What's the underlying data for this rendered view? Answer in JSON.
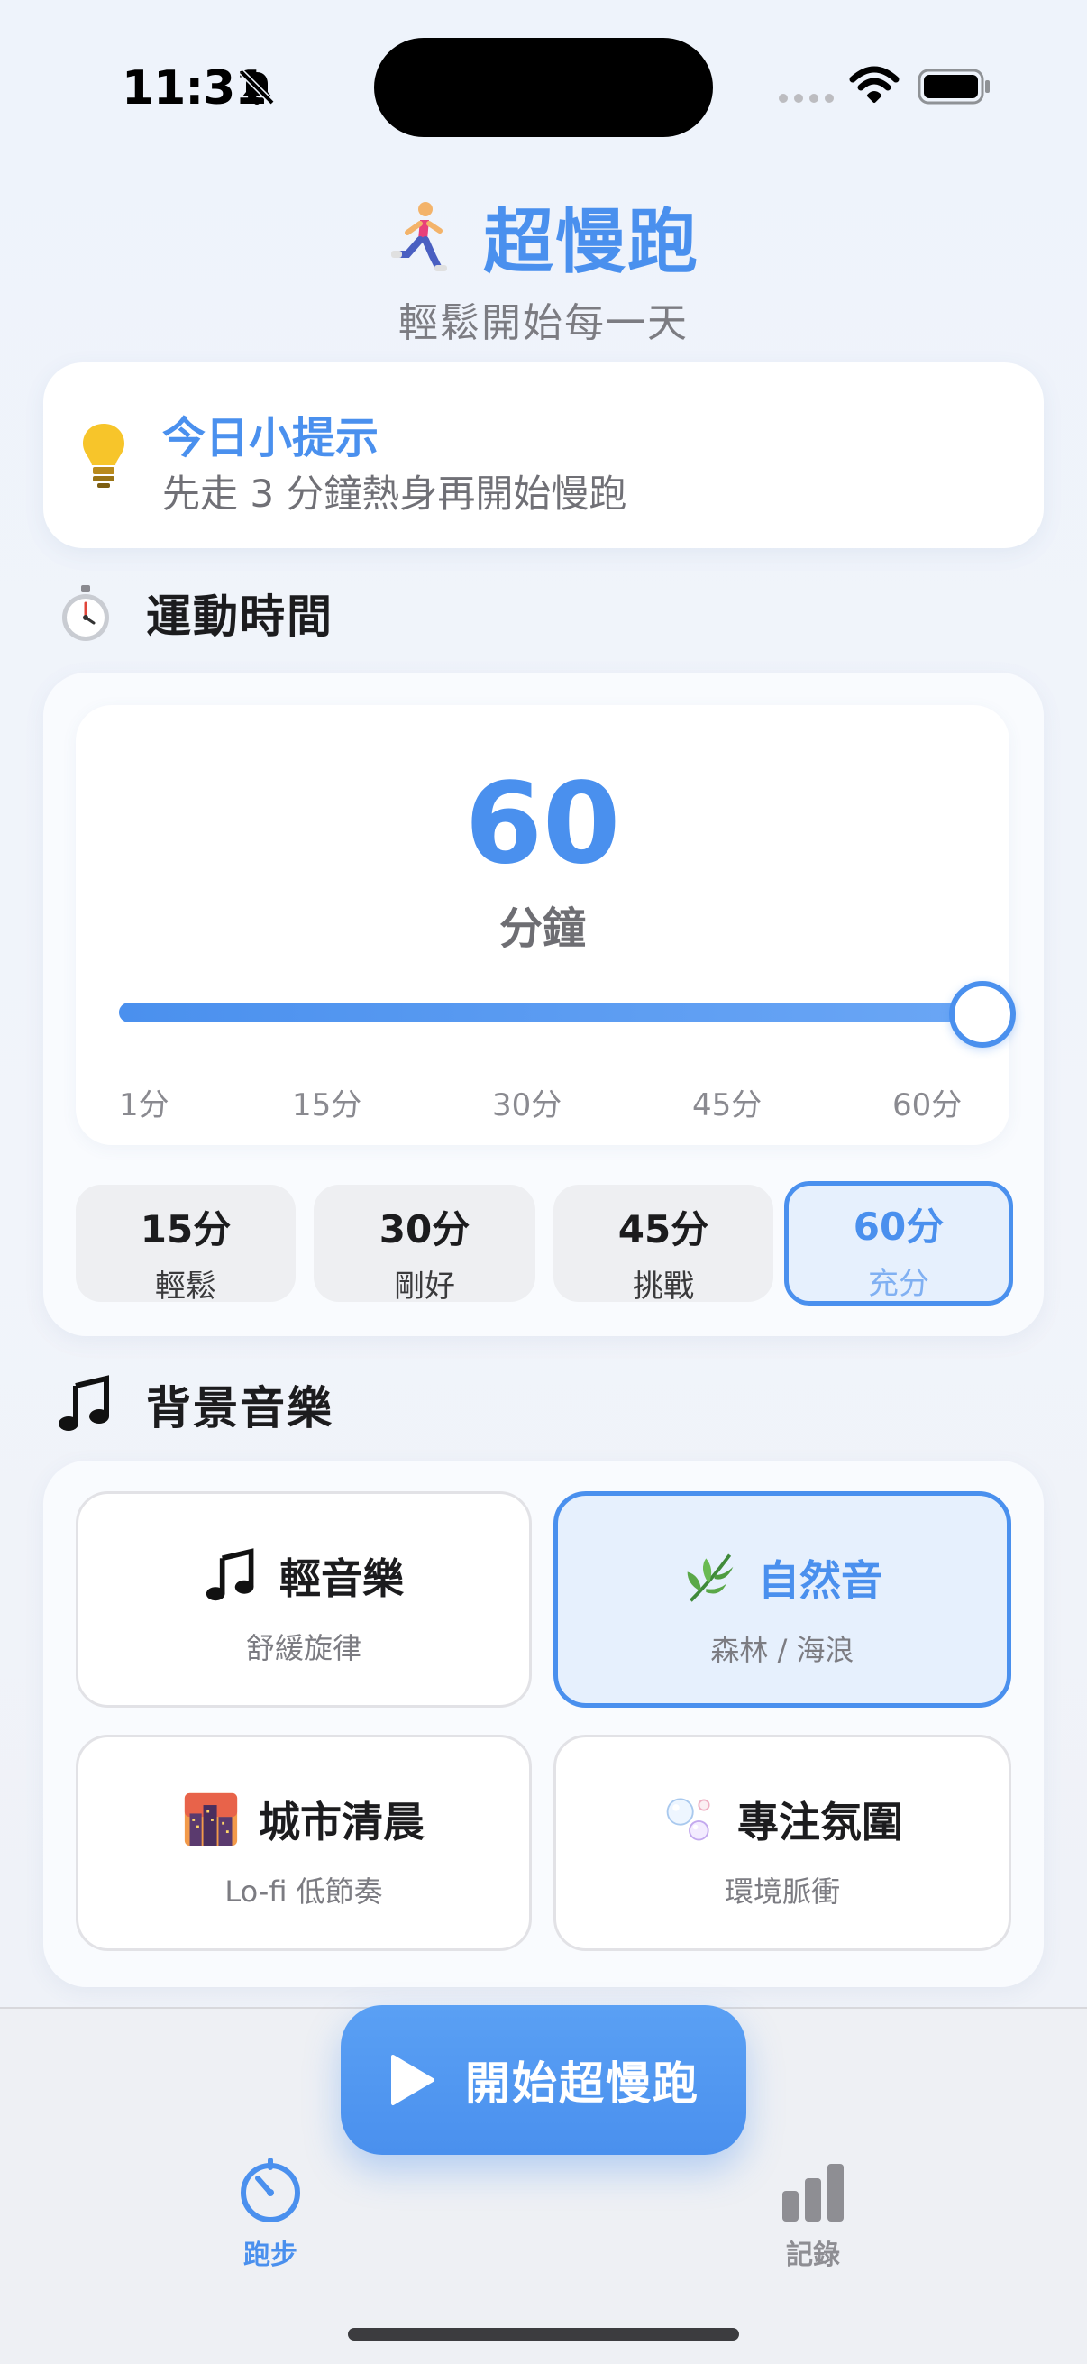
{
  "status_bar": {
    "time": "11:31"
  },
  "header": {
    "title": "超慢跑",
    "subtitle": "輕鬆開始每一天"
  },
  "tip": {
    "title": "今日小提示",
    "body": "先走 3 分鐘熱身再開始慢跑"
  },
  "duration_section": {
    "title": "運動時間",
    "value": "60",
    "unit": "分鐘",
    "slider": {
      "min": 1,
      "max": 60,
      "current": 60
    },
    "ticks": [
      "1分",
      "15分",
      "30分",
      "45分",
      "60分"
    ],
    "presets": [
      {
        "value": "15分",
        "label": "輕鬆",
        "selected": false
      },
      {
        "value": "30分",
        "label": "剛好",
        "selected": false
      },
      {
        "value": "45分",
        "label": "挑戰",
        "selected": false
      },
      {
        "value": "60分",
        "label": "充分",
        "selected": true
      }
    ]
  },
  "music_section": {
    "title": "背景音樂",
    "options": [
      {
        "name": "輕音樂",
        "desc": "舒緩旋律",
        "icon": "music-note-icon",
        "selected": false
      },
      {
        "name": "自然音",
        "desc": "森林 / 海浪",
        "icon": "herb-icon",
        "selected": true
      },
      {
        "name": "城市清晨",
        "desc": "Lo-fi 低節奏",
        "icon": "city-dusk-icon",
        "selected": false
      },
      {
        "name": "專注氛圍",
        "desc": "環境脈衝",
        "icon": "bubbles-icon",
        "selected": false
      }
    ]
  },
  "start_button": {
    "label": "開始超慢跑"
  },
  "tabs": [
    {
      "label": "跑步",
      "icon": "timer-icon",
      "active": true
    },
    {
      "label": "記錄",
      "icon": "bar-chart-icon",
      "active": false
    }
  ],
  "colors": {
    "accent": "#4A90EE",
    "tab_inactive": "#8E8E93"
  }
}
